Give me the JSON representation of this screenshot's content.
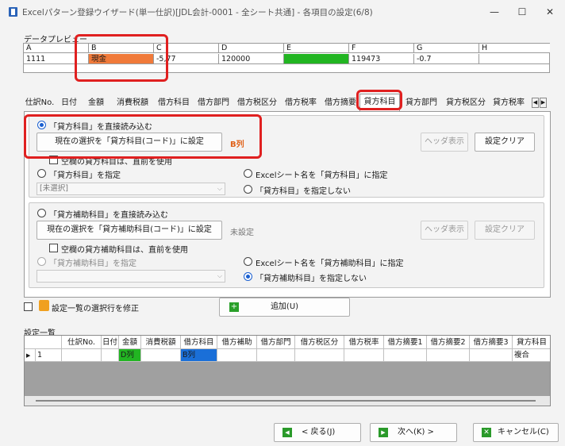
{
  "window": {
    "title": "Excelパターン登録ウイザード(単一仕訳)[JDL会計-0001 - 全シート共通] - 各項目の設定(6/8)",
    "minimize": "—",
    "maximize": "☐",
    "close": "✕"
  },
  "preview": {
    "label": "データプレビュー",
    "columns": [
      "A",
      "B",
      "C",
      "D",
      "E",
      "F",
      "G",
      "H"
    ],
    "values": [
      "1111",
      "現金",
      "-5,77",
      "120000",
      "",
      "119473",
      "-0.7",
      ""
    ],
    "highlight_colors": {
      "B": "#f07a3a",
      "E": "#22b522"
    }
  },
  "tabs": [
    "仕訳No.",
    "日付",
    "金額",
    "消費税額",
    "借方科目",
    "借方部門",
    "借方税区分",
    "借方税率",
    "借方摘要",
    "貸方科目",
    "貸方部門",
    "貸方税区分",
    "貸方税率"
  ],
  "active_tab": "貸方科目",
  "group1": {
    "radio_direct": "「貸方科目」を直接読み込む",
    "set_button": "現在の選択を「貸方科目(コード)」に設定",
    "status": "B列",
    "header_button": "ヘッダ表示",
    "clear_button": "設定クリア",
    "blank_check": "空欄の貸方科目は、直前を使用",
    "radio_specify": "「貸方科目」を指定",
    "select_value": "[未選択]",
    "radio_sheet": "Excelシート名を「貸方科目」に指定",
    "radio_none": "「貸方科目」を指定しない"
  },
  "group2": {
    "radio_direct": "「貸方補助科目」を直接読み込む",
    "set_button": "現在の選択を「貸方補助科目(コード)」に設定",
    "status": "未設定",
    "header_button": "ヘッダ表示",
    "clear_button": "設定クリア",
    "blank_check": "空欄の貸方補助科目は、直前を使用",
    "radio_specify": "「貸方補助科目」を指定",
    "select_value": "",
    "radio_sheet": "Excelシート名を「貸方補助科目」に指定",
    "radio_none": "「貸方補助科目」を指定しない"
  },
  "modify_check": "設定一覧の選択行を修正",
  "add_button": "追加(U)",
  "list": {
    "label": "設定一覧",
    "headers": [
      "仕訳No.",
      "日付",
      "金額",
      "消費税額",
      "借方科目",
      "借方補助",
      "借方部門",
      "借方税区分",
      "借方税率",
      "借方摘要1",
      "借方摘要2",
      "借方摘要3",
      "貸方科目"
    ],
    "row": {
      "indicator": "▶",
      "num": "1",
      "cells": [
        "",
        "",
        "D列",
        "",
        "B列",
        "",
        "",
        "",
        "",
        "",
        "",
        "",
        "複合"
      ]
    },
    "cell_colors": {
      "amount": "#22b522",
      "debit": "#1a6fd8"
    }
  },
  "footer": {
    "back": "< 戻る(J)",
    "next": "次へ(K) >",
    "cancel": "キャンセル(C)"
  }
}
